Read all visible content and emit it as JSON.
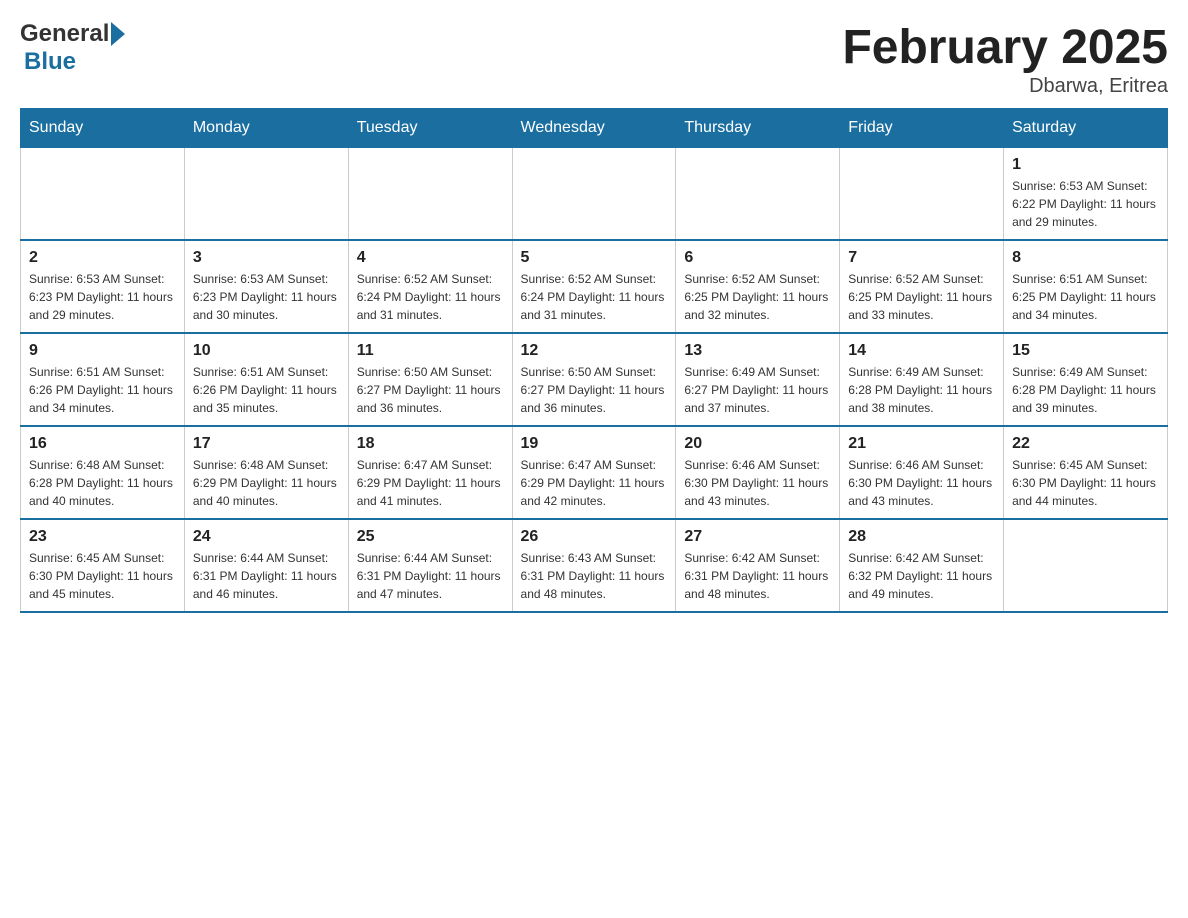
{
  "header": {
    "title": "February 2025",
    "location": "Dbarwa, Eritrea",
    "logo_general": "General",
    "logo_blue": "Blue"
  },
  "days_of_week": [
    "Sunday",
    "Monday",
    "Tuesday",
    "Wednesday",
    "Thursday",
    "Friday",
    "Saturday"
  ],
  "weeks": [
    [
      {
        "date": "",
        "info": ""
      },
      {
        "date": "",
        "info": ""
      },
      {
        "date": "",
        "info": ""
      },
      {
        "date": "",
        "info": ""
      },
      {
        "date": "",
        "info": ""
      },
      {
        "date": "",
        "info": ""
      },
      {
        "date": "1",
        "info": "Sunrise: 6:53 AM\nSunset: 6:22 PM\nDaylight: 11 hours and 29 minutes."
      }
    ],
    [
      {
        "date": "2",
        "info": "Sunrise: 6:53 AM\nSunset: 6:23 PM\nDaylight: 11 hours and 29 minutes."
      },
      {
        "date": "3",
        "info": "Sunrise: 6:53 AM\nSunset: 6:23 PM\nDaylight: 11 hours and 30 minutes."
      },
      {
        "date": "4",
        "info": "Sunrise: 6:52 AM\nSunset: 6:24 PM\nDaylight: 11 hours and 31 minutes."
      },
      {
        "date": "5",
        "info": "Sunrise: 6:52 AM\nSunset: 6:24 PM\nDaylight: 11 hours and 31 minutes."
      },
      {
        "date": "6",
        "info": "Sunrise: 6:52 AM\nSunset: 6:25 PM\nDaylight: 11 hours and 32 minutes."
      },
      {
        "date": "7",
        "info": "Sunrise: 6:52 AM\nSunset: 6:25 PM\nDaylight: 11 hours and 33 minutes."
      },
      {
        "date": "8",
        "info": "Sunrise: 6:51 AM\nSunset: 6:25 PM\nDaylight: 11 hours and 34 minutes."
      }
    ],
    [
      {
        "date": "9",
        "info": "Sunrise: 6:51 AM\nSunset: 6:26 PM\nDaylight: 11 hours and 34 minutes."
      },
      {
        "date": "10",
        "info": "Sunrise: 6:51 AM\nSunset: 6:26 PM\nDaylight: 11 hours and 35 minutes."
      },
      {
        "date": "11",
        "info": "Sunrise: 6:50 AM\nSunset: 6:27 PM\nDaylight: 11 hours and 36 minutes."
      },
      {
        "date": "12",
        "info": "Sunrise: 6:50 AM\nSunset: 6:27 PM\nDaylight: 11 hours and 36 minutes."
      },
      {
        "date": "13",
        "info": "Sunrise: 6:49 AM\nSunset: 6:27 PM\nDaylight: 11 hours and 37 minutes."
      },
      {
        "date": "14",
        "info": "Sunrise: 6:49 AM\nSunset: 6:28 PM\nDaylight: 11 hours and 38 minutes."
      },
      {
        "date": "15",
        "info": "Sunrise: 6:49 AM\nSunset: 6:28 PM\nDaylight: 11 hours and 39 minutes."
      }
    ],
    [
      {
        "date": "16",
        "info": "Sunrise: 6:48 AM\nSunset: 6:28 PM\nDaylight: 11 hours and 40 minutes."
      },
      {
        "date": "17",
        "info": "Sunrise: 6:48 AM\nSunset: 6:29 PM\nDaylight: 11 hours and 40 minutes."
      },
      {
        "date": "18",
        "info": "Sunrise: 6:47 AM\nSunset: 6:29 PM\nDaylight: 11 hours and 41 minutes."
      },
      {
        "date": "19",
        "info": "Sunrise: 6:47 AM\nSunset: 6:29 PM\nDaylight: 11 hours and 42 minutes."
      },
      {
        "date": "20",
        "info": "Sunrise: 6:46 AM\nSunset: 6:30 PM\nDaylight: 11 hours and 43 minutes."
      },
      {
        "date": "21",
        "info": "Sunrise: 6:46 AM\nSunset: 6:30 PM\nDaylight: 11 hours and 43 minutes."
      },
      {
        "date": "22",
        "info": "Sunrise: 6:45 AM\nSunset: 6:30 PM\nDaylight: 11 hours and 44 minutes."
      }
    ],
    [
      {
        "date": "23",
        "info": "Sunrise: 6:45 AM\nSunset: 6:30 PM\nDaylight: 11 hours and 45 minutes."
      },
      {
        "date": "24",
        "info": "Sunrise: 6:44 AM\nSunset: 6:31 PM\nDaylight: 11 hours and 46 minutes."
      },
      {
        "date": "25",
        "info": "Sunrise: 6:44 AM\nSunset: 6:31 PM\nDaylight: 11 hours and 47 minutes."
      },
      {
        "date": "26",
        "info": "Sunrise: 6:43 AM\nSunset: 6:31 PM\nDaylight: 11 hours and 48 minutes."
      },
      {
        "date": "27",
        "info": "Sunrise: 6:42 AM\nSunset: 6:31 PM\nDaylight: 11 hours and 48 minutes."
      },
      {
        "date": "28",
        "info": "Sunrise: 6:42 AM\nSunset: 6:32 PM\nDaylight: 11 hours and 49 minutes."
      },
      {
        "date": "",
        "info": ""
      }
    ]
  ]
}
